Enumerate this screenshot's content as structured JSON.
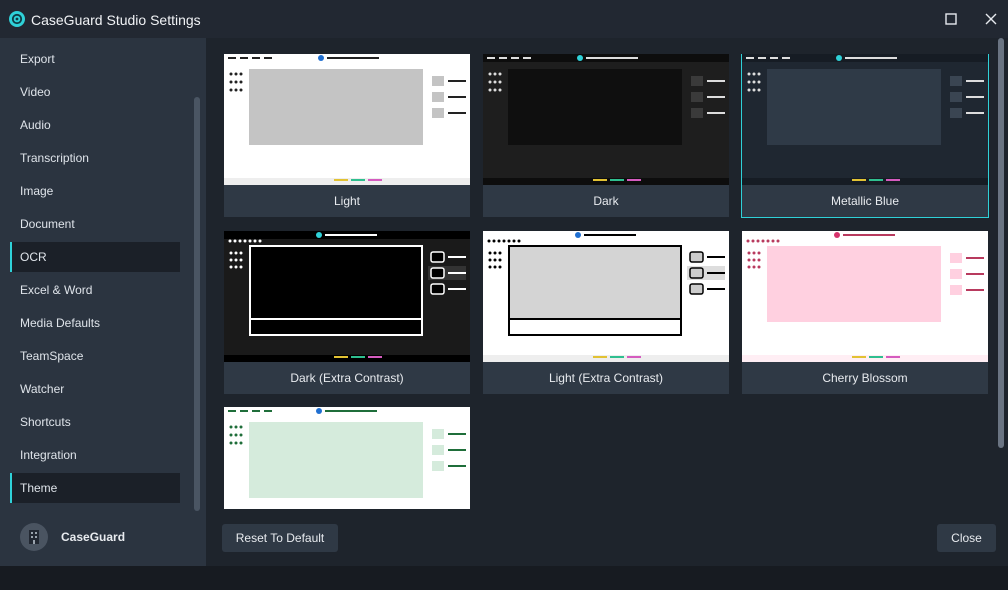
{
  "window": {
    "title": "CaseGuard Studio Settings"
  },
  "sidebar": {
    "items": [
      {
        "label": "Export"
      },
      {
        "label": "Video"
      },
      {
        "label": "Audio"
      },
      {
        "label": "Transcription"
      },
      {
        "label": "Image"
      },
      {
        "label": "Document"
      },
      {
        "label": "OCR",
        "active": true
      },
      {
        "label": "Excel & Word"
      },
      {
        "label": "Media Defaults"
      },
      {
        "label": "TeamSpace"
      },
      {
        "label": "Watcher"
      },
      {
        "label": "Shortcuts"
      },
      {
        "label": "Integration"
      },
      {
        "label": "Theme",
        "active": true
      }
    ],
    "brand": "CaseGuard"
  },
  "themes": [
    {
      "label": "Light",
      "selected": false
    },
    {
      "label": "Dark",
      "selected": false
    },
    {
      "label": "Metallic Blue",
      "selected": true
    },
    {
      "label": "Dark (Extra Contrast)",
      "selected": false
    },
    {
      "label": "Light (Extra Contrast)",
      "selected": false
    },
    {
      "label": "Cherry Blossom",
      "selected": false
    },
    {
      "label": "",
      "selected": false
    }
  ],
  "buttons": {
    "reset": "Reset To Default",
    "close": "Close"
  },
  "colors": {
    "accent": "#2fd1d8",
    "sidebar": "#2b3440",
    "main": "#1e242c",
    "card_label": "#2f3945"
  }
}
